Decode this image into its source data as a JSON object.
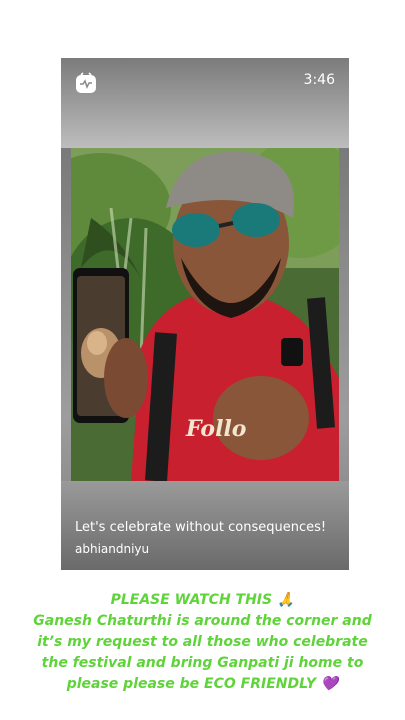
{
  "story": {
    "time": "3:46",
    "caption": "Let's celebrate without consequences!",
    "username": "abhiandniyu",
    "shirt_text": "Follo"
  },
  "message": {
    "lines": [
      "PLEASE WATCH THIS 🙏",
      "Ganesh Chaturthi is around the corner and",
      "it’s my request to all those who celebrate",
      "the festival and bring Ganpati ji home to",
      "please please be ECO FRIENDLY 💜"
    ],
    "color": "#5fd33a"
  },
  "icons": {
    "app": "app-logo-icon"
  }
}
